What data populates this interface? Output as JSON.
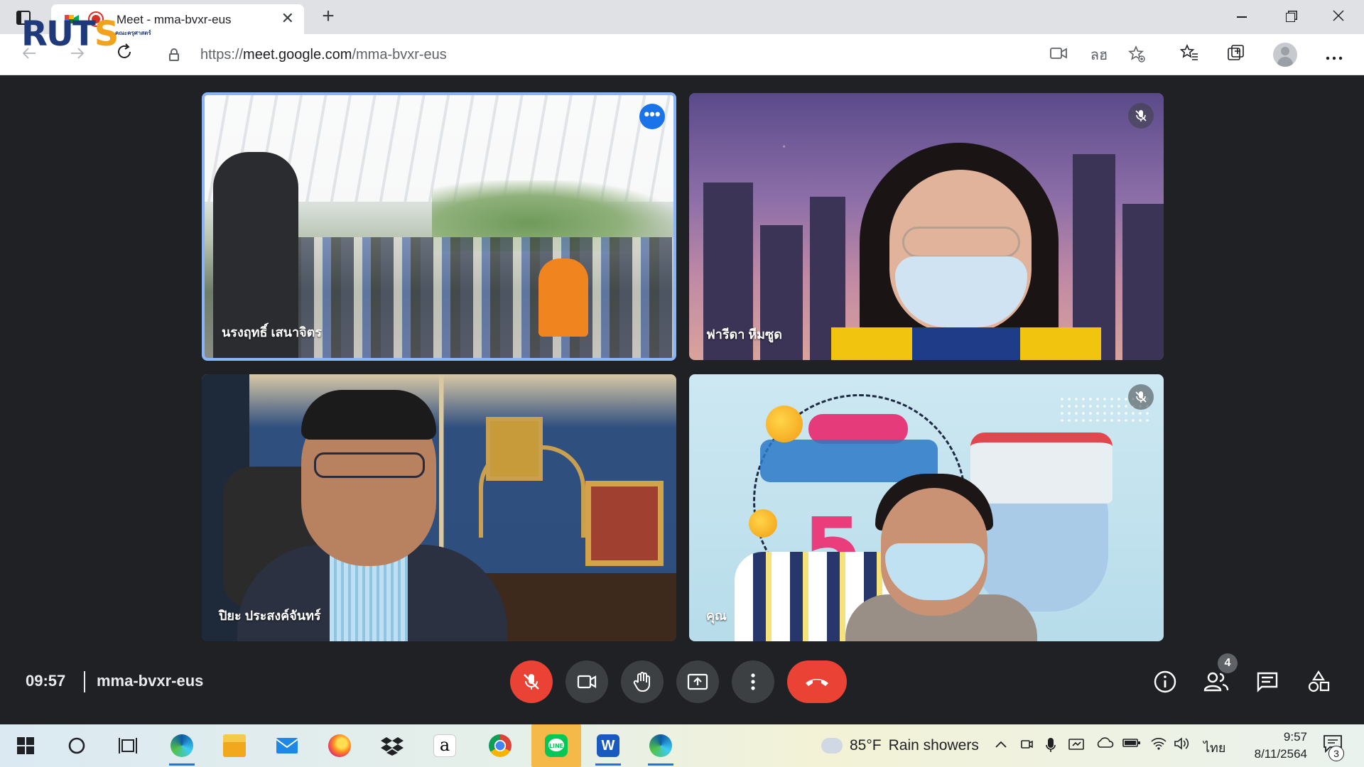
{
  "browser": {
    "tab_title": "Meet - mma-bvxr-eus",
    "tab_close": "✕",
    "new_tab": "+",
    "url_scheme": "https://",
    "url_host": "meet.google.com",
    "url_path": "/mma-bvxr-eus",
    "translate_label": "ลฮ"
  },
  "logo": {
    "text_main": "RUT",
    "text_accent": "S",
    "subtitle": "คณะครุศาสตร์"
  },
  "tiles": [
    {
      "name": "นรงฤทธิ์ เสนาจิตร",
      "muted": false,
      "pinned_menu": true
    },
    {
      "name": "ฟารีดา หีมซูด",
      "muted": true
    },
    {
      "name": "ปิยะ ประสงค์จันทร์",
      "muted": false
    },
    {
      "name": "คุณ",
      "muted": true
    }
  ],
  "meeting": {
    "time": "09:57",
    "code": "mma-bvxr-eus",
    "participant_count": "4"
  },
  "taskbar": {
    "weather_temp": "85°F",
    "weather_desc": "Rain showers",
    "language": "ไทย",
    "clock_time": "9:57",
    "clock_date": "8/11/2564",
    "notification_count": "3"
  },
  "colors": {
    "meet_bg": "#202124",
    "danger_red": "#ea4335",
    "control_gray": "#3c4043",
    "active_tile_border": "#8ab4f8",
    "accent_blue": "#1a73e8"
  },
  "icons": {
    "mic": "mic-off-icon",
    "camera": "camera-icon",
    "hand": "raise-hand-icon",
    "present": "present-screen-icon",
    "more": "more-vertical-icon",
    "hangup": "hang-up-icon",
    "info": "info-icon",
    "people": "people-icon",
    "chat": "chat-icon",
    "activities": "activities-icon"
  }
}
